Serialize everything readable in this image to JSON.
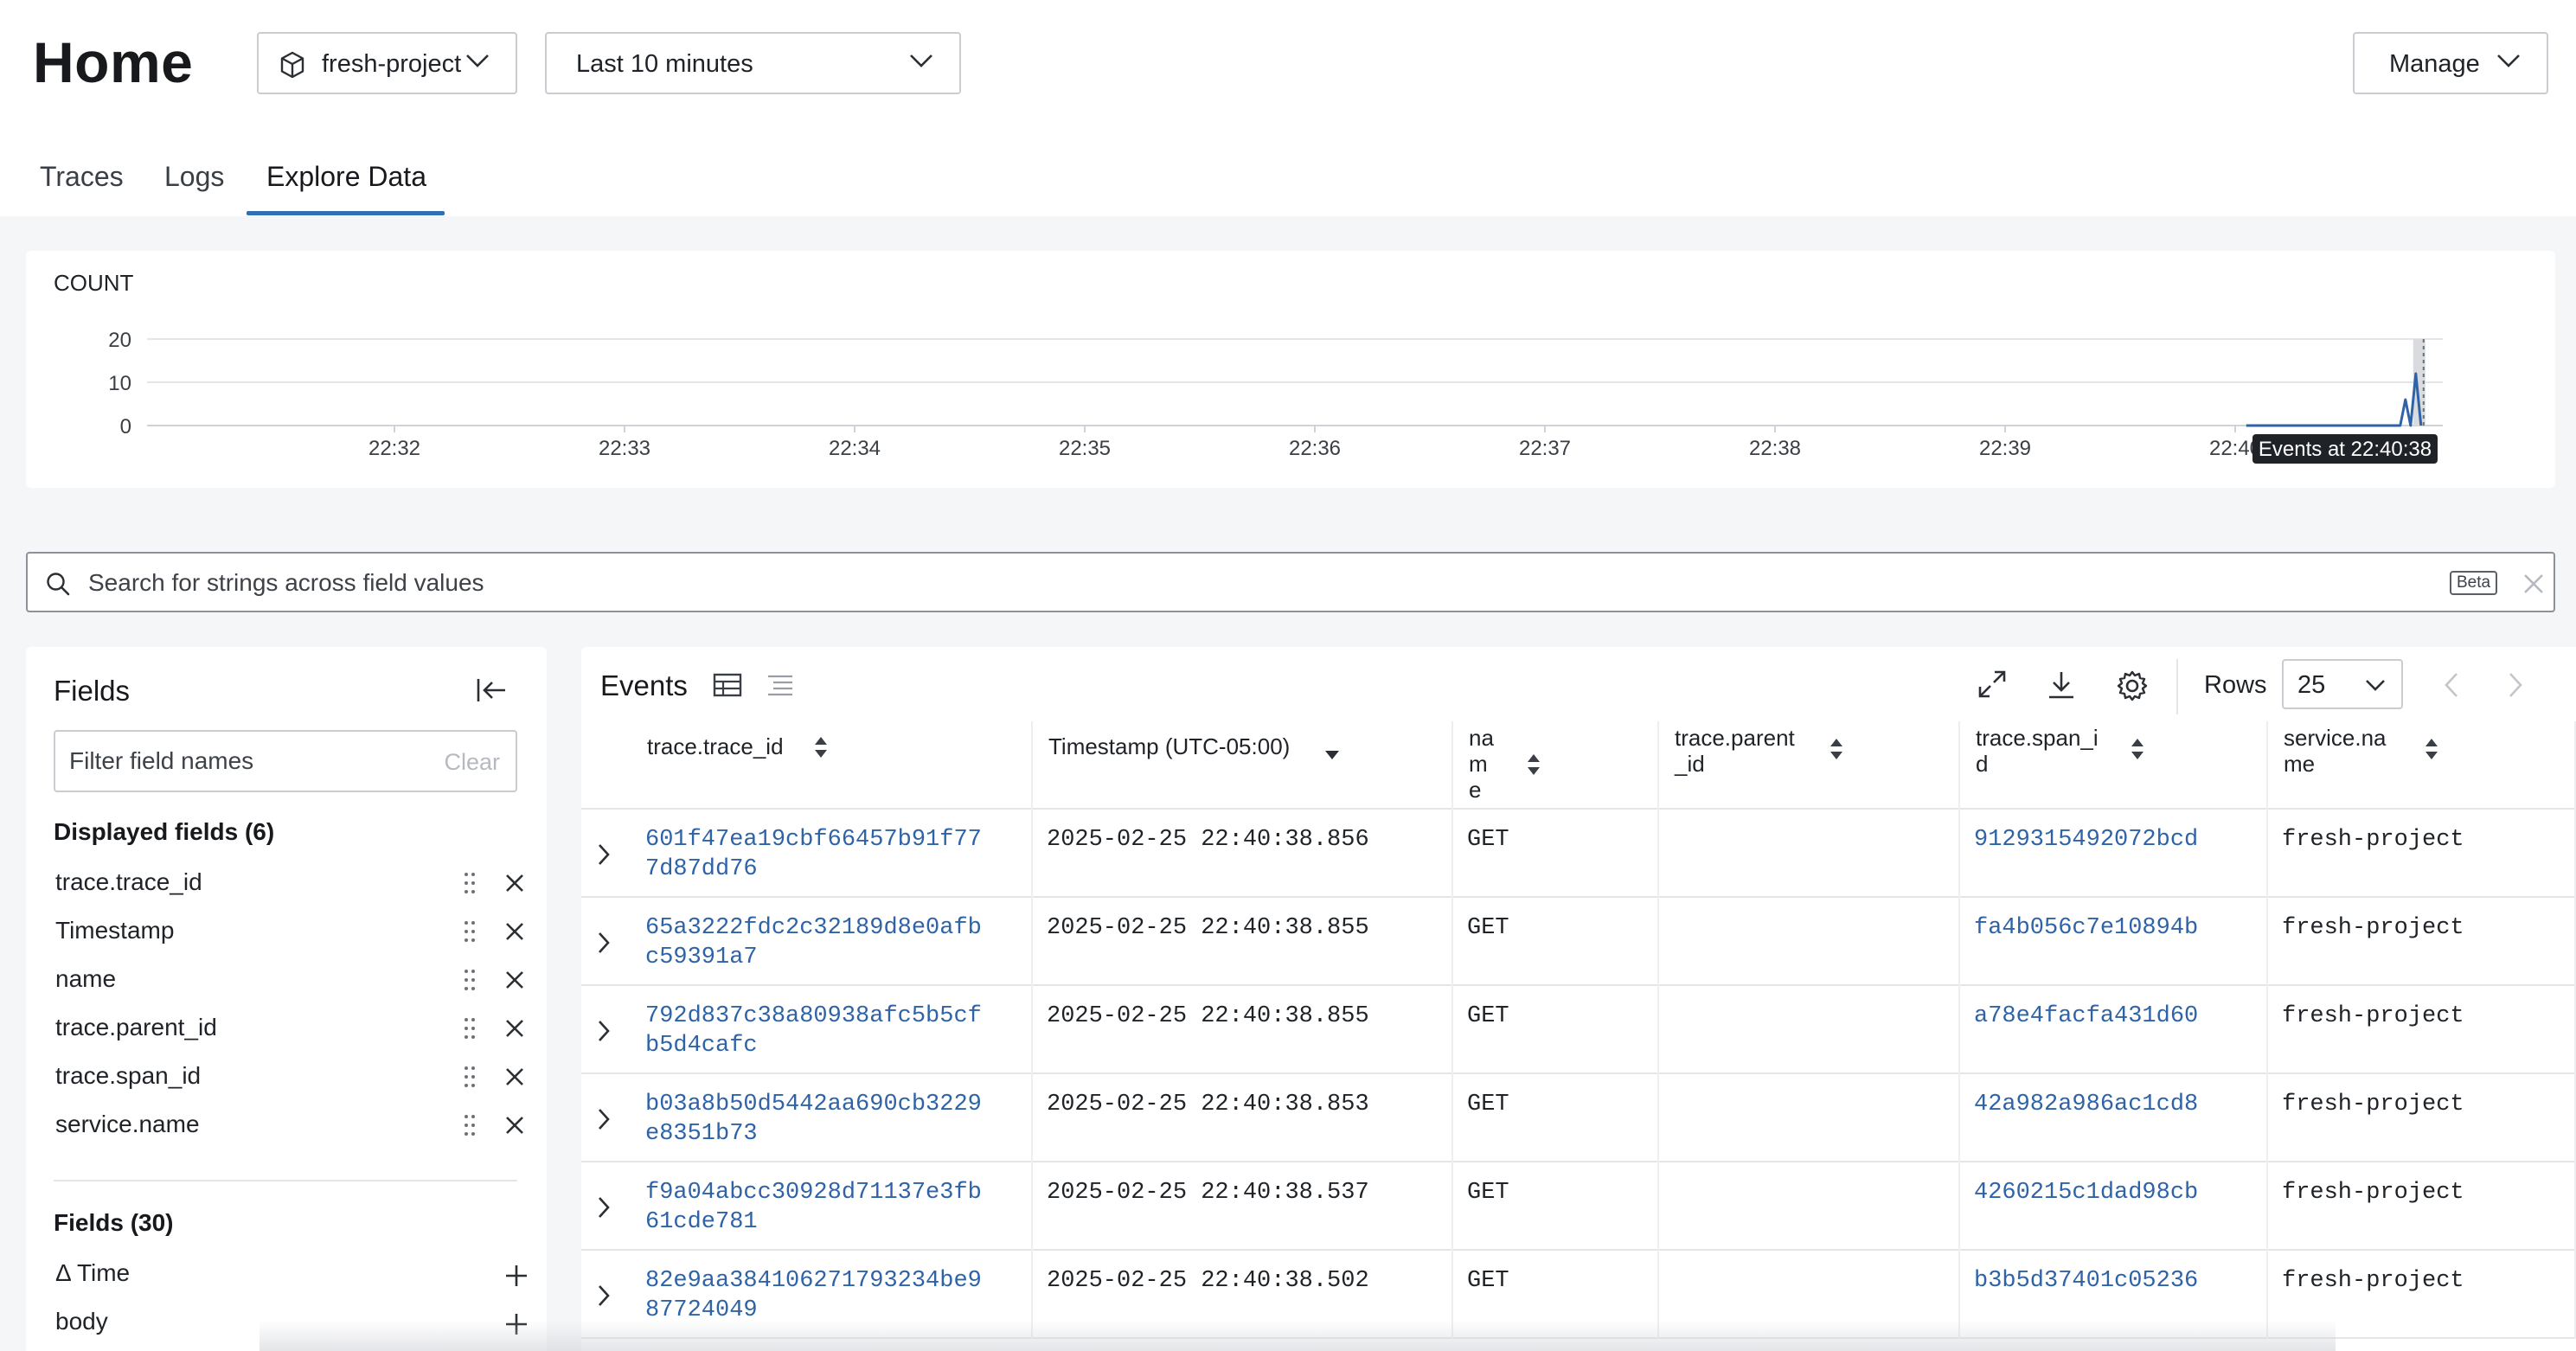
{
  "header": {
    "title": "Home",
    "project": "fresh-project",
    "time_range": "Last 10 minutes",
    "manage_label": "Manage"
  },
  "tabs": [
    {
      "label": "Traces",
      "active": false
    },
    {
      "label": "Logs",
      "active": false
    },
    {
      "label": "Explore Data",
      "active": true
    }
  ],
  "accent_color": "#2f6fb5",
  "chart_data": {
    "type": "line",
    "ylabel": "COUNT",
    "yticks": [
      "20",
      "10",
      "0"
    ],
    "ylim": [
      0,
      20
    ],
    "categories": [
      "22:32",
      "22:33",
      "22:34",
      "22:35",
      "22:36",
      "22:37",
      "22:38",
      "22:39",
      "22:40"
    ],
    "series": [
      {
        "values": [
          0,
          0,
          0,
          0,
          0,
          0,
          0,
          0,
          0,
          0,
          0,
          0,
          0,
          0,
          0,
          0,
          0,
          6,
          0,
          12,
          0
        ]
      }
    ],
    "x_range": [
      "22:31",
      "22:41"
    ],
    "grid": true,
    "annotation": "Events at 22:40:38",
    "line_color": "#2f63a8"
  },
  "search": {
    "placeholder": "Search for strings across field values",
    "badge": "Beta"
  },
  "fields_panel": {
    "title": "Fields",
    "filter_placeholder": "Filter field names",
    "clear_label": "Clear",
    "displayed_label": "Displayed fields (6)",
    "displayed": [
      "trace.trace_id",
      "Timestamp",
      "name",
      "trace.parent_id",
      "trace.span_id",
      "service.name"
    ],
    "all_label": "Fields (30)",
    "all": [
      "Δ Time",
      "body"
    ]
  },
  "events": {
    "title": "Events",
    "rows_label": "Rows",
    "rows_value": "25",
    "columns": [
      {
        "line1": "trace.trace_id",
        "line2": "",
        "line3": ""
      },
      {
        "line1": "Timestamp (UTC-05:00)",
        "line2": "",
        "line3": ""
      },
      {
        "line1": "na",
        "line2": "m",
        "line3": "e"
      },
      {
        "line1": "trace.parent",
        "line2": "_id",
        "line3": ""
      },
      {
        "line1": "trace.span_i",
        "line2": "d",
        "line3": ""
      },
      {
        "line1": "service.na",
        "line2": "me",
        "line3": ""
      }
    ],
    "rows": [
      {
        "trace_id_1": "601f47ea19cbf66457b91f77",
        "trace_id_2": "7d87dd76",
        "timestamp": "2025-02-25 22:40:38.856",
        "name": "GET",
        "parent_id": "",
        "span_id": "9129315492072bcd",
        "service": "fresh-project"
      },
      {
        "trace_id_1": "65a3222fdc2c32189d8e0afb",
        "trace_id_2": "c59391a7",
        "timestamp": "2025-02-25 22:40:38.855",
        "name": "GET",
        "parent_id": "",
        "span_id": "fa4b056c7e10894b",
        "service": "fresh-project"
      },
      {
        "trace_id_1": "792d837c38a80938afc5b5cf",
        "trace_id_2": "b5d4cafc",
        "timestamp": "2025-02-25 22:40:38.855",
        "name": "GET",
        "parent_id": "",
        "span_id": "a78e4facfa431d60",
        "service": "fresh-project"
      },
      {
        "trace_id_1": "b03a8b50d5442aa690cb3229",
        "trace_id_2": "e8351b73",
        "timestamp": "2025-02-25 22:40:38.853",
        "name": "GET",
        "parent_id": "",
        "span_id": "42a982a986ac1cd8",
        "service": "fresh-project"
      },
      {
        "trace_id_1": "f9a04abcc30928d71137e3fb",
        "trace_id_2": "61cde781",
        "timestamp": "2025-02-25 22:40:38.537",
        "name": "GET",
        "parent_id": "",
        "span_id": "4260215c1dad98cb",
        "service": "fresh-project"
      },
      {
        "trace_id_1": "82e9aa384106271793234be9",
        "trace_id_2": "87724049",
        "timestamp": "2025-02-25 22:40:38.502",
        "name": "GET",
        "parent_id": "",
        "span_id": "b3b5d37401c05236",
        "service": "fresh-project"
      }
    ]
  }
}
